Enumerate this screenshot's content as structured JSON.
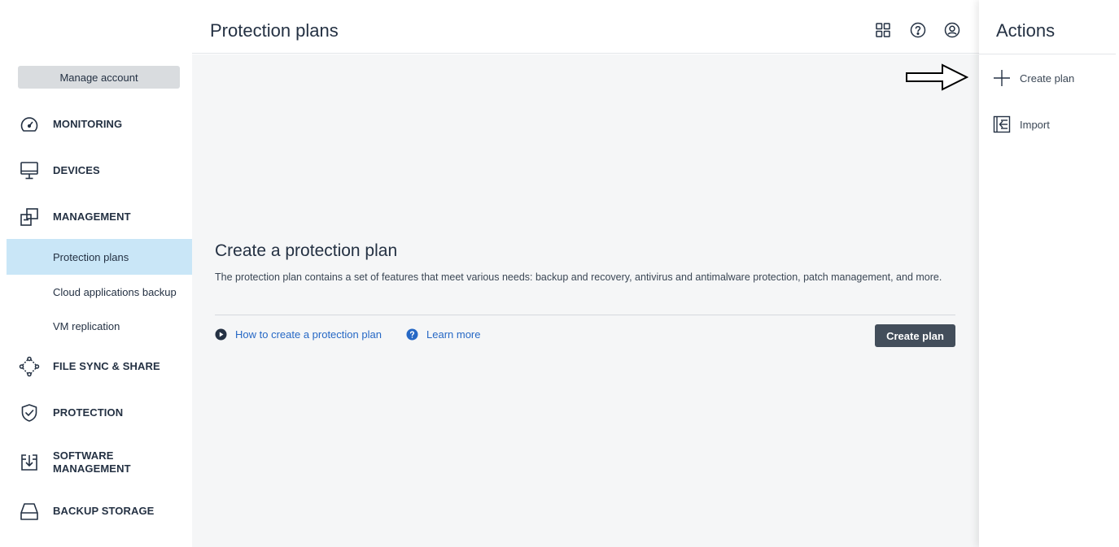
{
  "sidebar": {
    "manage_account": "Manage account",
    "items": [
      {
        "label": "MONITORING",
        "icon": "gauge-icon"
      },
      {
        "label": "DEVICES",
        "icon": "monitor-icon"
      },
      {
        "label": "MANAGEMENT",
        "icon": "management-icon"
      },
      {
        "label": "FILE SYNC & SHARE",
        "icon": "share-nodes-icon"
      },
      {
        "label": "PROTECTION",
        "icon": "shield-check-icon"
      },
      {
        "label": "SOFTWARE MANAGEMENT",
        "label_line1": "SOFTWARE",
        "label_line2": "MANAGEMENT",
        "icon": "software-download-icon"
      },
      {
        "label": "BACKUP STORAGE",
        "icon": "storage-drive-icon"
      }
    ],
    "subitems": [
      {
        "label": "Protection plans",
        "active": true
      },
      {
        "label": "Cloud applications backup",
        "active": false
      },
      {
        "label": "VM replication",
        "active": false
      }
    ]
  },
  "header": {
    "title": "Protection plans",
    "icons": [
      "apps-grid-icon",
      "help-icon",
      "user-account-icon"
    ]
  },
  "main": {
    "empty_title": "Create a protection plan",
    "empty_description": "The protection plan contains a set of features that meet various needs: backup and recovery, antivirus and antimalware protection, patch management, and more.",
    "link_how_to": "How to create a protection plan",
    "link_learn_more": "Learn more",
    "create_button": "Create plan"
  },
  "actions": {
    "title": "Actions",
    "items": [
      {
        "label": "Create plan",
        "icon": "plus-icon"
      },
      {
        "label": "Import",
        "icon": "import-icon"
      }
    ]
  },
  "colors": {
    "accent_link": "#2668c5",
    "active_subitem": "#c9e6f7",
    "primary_button": "#434e5b",
    "main_background": "#f5f6f7"
  }
}
